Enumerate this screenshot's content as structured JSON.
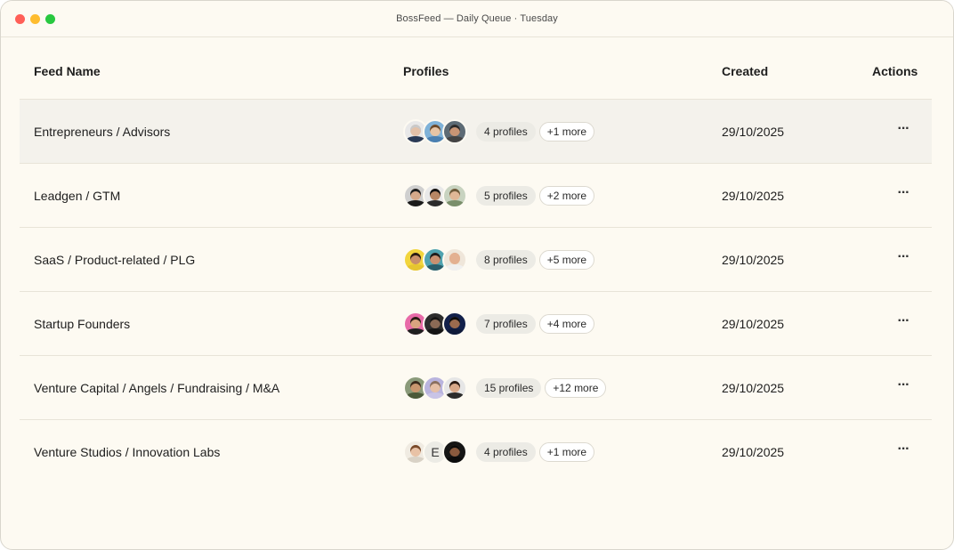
{
  "window": {
    "title": "BossFeed — Daily Queue · Tuesday"
  },
  "table": {
    "headers": {
      "name": "Feed Name",
      "profiles": "Profiles",
      "created": "Created",
      "actions": "Actions"
    },
    "actions_icon": "more-horizontal-icon",
    "rows": [
      {
        "name": "Entrepreneurs / Advisors",
        "profiles_count": "4 profiles",
        "more": "+1 more",
        "created": "29/10/2025",
        "actions": "···",
        "avatars": [
          {
            "skin": "#e3c1a8",
            "hair": "#c9c9c9",
            "shirt": "#2a3a55",
            "bg": "#e8e8e8",
            "letter": ""
          },
          {
            "skin": "#e6c4a5",
            "hair": "#6b4a2b",
            "shirt": "#4a7fb0",
            "bg": "#7fb2d8",
            "letter": ""
          },
          {
            "skin": "#c99575",
            "hair": "#2b2b2b",
            "shirt": "#444444",
            "bg": "#5d6b75",
            "letter": ""
          }
        ]
      },
      {
        "name": "Leadgen / GTM",
        "profiles_count": "5 profiles",
        "more": "+2 more",
        "created": "29/10/2025",
        "actions": "···",
        "avatars": [
          {
            "skin": "#d6a98a",
            "hair": "#1e1e1e",
            "shirt": "#1b1b1b",
            "bg": "#cfcfcf",
            "letter": ""
          },
          {
            "skin": "#b78664",
            "hair": "#111111",
            "shirt": "#2b2b2b",
            "bg": "#e9e9e9",
            "letter": ""
          },
          {
            "skin": "#e0b796",
            "hair": "#6d5a3a",
            "shirt": "#7a8f6b",
            "bg": "#c8d3c0",
            "letter": ""
          }
        ]
      },
      {
        "name": "SaaS / Product-related / PLG",
        "profiles_count": "8 profiles",
        "more": "+5 more",
        "created": "29/10/2025",
        "actions": "···",
        "avatars": [
          {
            "skin": "#c98f6a",
            "hair": "#2a1d14",
            "shirt": "#e6c530",
            "bg": "#f2d53c",
            "letter": ""
          },
          {
            "skin": "#c99070",
            "hair": "#1d1d1d",
            "shirt": "#2a5e6b",
            "bg": "#4fa3b0",
            "letter": ""
          },
          {
            "skin": "#e3b091",
            "hair": "#e3b091",
            "shirt": "#f0f0f0",
            "bg": "#efe6da",
            "letter": ""
          }
        ]
      },
      {
        "name": "Startup Founders",
        "profiles_count": "7 profiles",
        "more": "+4 more",
        "created": "29/10/2025",
        "actions": "···",
        "avatars": [
          {
            "skin": "#d9a37f",
            "hair": "#2a1a14",
            "shirt": "#1f1f1f",
            "bg": "#e86aa8",
            "letter": ""
          },
          {
            "skin": "#8a6a55",
            "hair": "#151515",
            "shirt": "#151515",
            "bg": "#2d2d2d",
            "letter": ""
          },
          {
            "skin": "#9c6b4e",
            "hair": "#0c0c0c",
            "shirt": "#0f1a3a",
            "bg": "#12204a",
            "letter": ""
          }
        ]
      },
      {
        "name": "Venture Capital / Angels / Fundraising / M&A",
        "profiles_count": "15 profiles",
        "more": "+12 more",
        "created": "29/10/2025",
        "actions": "···",
        "avatars": [
          {
            "skin": "#c9966f",
            "hair": "#3a2a1c",
            "shirt": "#4b5a3a",
            "bg": "#8a9a7a",
            "letter": ""
          },
          {
            "skin": "#e6c0a6",
            "hair": "#8a7060",
            "shirt": "#c9c4e6",
            "bg": "#b9b4de",
            "letter": ""
          },
          {
            "skin": "#d8a888",
            "hair": "#2a1a12",
            "shirt": "#2b2b2b",
            "bg": "#e6e6e6",
            "letter": ""
          }
        ]
      },
      {
        "name": "Venture Studios / Innovation Labs",
        "profiles_count": "4 profiles",
        "more": "+1 more",
        "created": "29/10/2025",
        "actions": "···",
        "avatars": [
          {
            "skin": "#e8c2a6",
            "hair": "#7a4a2a",
            "shirt": "#d9d2c6",
            "bg": "#f0ebe2",
            "letter": ""
          },
          {
            "skin": "",
            "hair": "",
            "shirt": "",
            "bg": "#ecebe5",
            "letter": "E"
          },
          {
            "skin": "#8a5a3e",
            "hair": "#0c0c0c",
            "shirt": "#0c0c0c",
            "bg": "#151515",
            "letter": ""
          }
        ]
      }
    ]
  }
}
